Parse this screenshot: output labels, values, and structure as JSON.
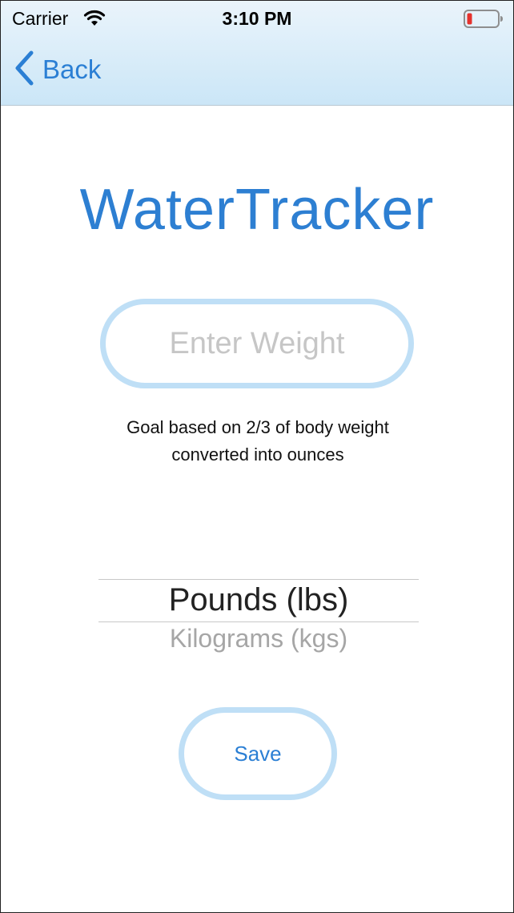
{
  "status_bar": {
    "carrier": "Carrier",
    "time": "3:10 PM",
    "signal_icon": "wifi-icon",
    "battery_icon": "battery-low-icon",
    "battery_color": "#e5322d"
  },
  "nav": {
    "back_label": "Back",
    "back_icon": "chevron-left-icon"
  },
  "app_title": "WaterTracker",
  "weight_input": {
    "placeholder": "Enter Weight",
    "value": ""
  },
  "goal_note": {
    "line1": "Goal based on 2/3 of body weight",
    "line2": "converted into ounces"
  },
  "unit_picker": {
    "selected": "Pounds (lbs)",
    "options": [
      "Pounds (lbs)",
      "Kilograms (kgs)"
    ]
  },
  "save_button": {
    "label": "Save"
  },
  "colors": {
    "accent": "#2b7fd4",
    "field_border": "#bfdff6",
    "nav_bar_top": "#eaf4fb",
    "nav_bar_bottom": "#cbe6f7"
  }
}
